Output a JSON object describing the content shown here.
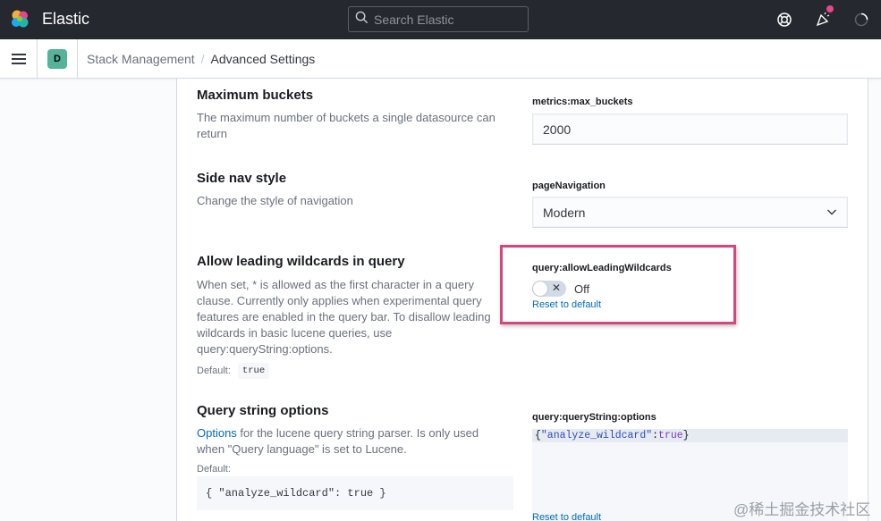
{
  "header": {
    "brand": "Elastic",
    "search_placeholder": "Search Elastic"
  },
  "subheader": {
    "space_initial": "D",
    "breadcrumbs": [
      "Stack Management",
      "Advanced Settings"
    ]
  },
  "settings": [
    {
      "title": "Maximum buckets",
      "description": "The maximum number of buckets a single datasource can return",
      "key": "metrics:max_buckets",
      "value": "2000"
    },
    {
      "title": "Side nav style",
      "description": "Change the style of navigation",
      "key": "pageNavigation",
      "value": "Modern"
    },
    {
      "title": "Allow leading wildcards in query",
      "description": "When set, * is allowed as the first character in a query clause. Currently only applies when experimental query features are enabled in the query bar. To disallow leading wildcards in basic lucene queries, use query:queryString:options.",
      "default_label": "Default:",
      "default_value": "true",
      "key": "query:allowLeadingWildcards",
      "toggle_label": "Off",
      "reset_label": "Reset to default"
    },
    {
      "title": "Query string options",
      "description_link": "Options",
      "description_rest": " for the lucene query string parser. Is only used when \"Query language\" is set to Lucene.",
      "default_label": "Default:",
      "default_value": "{ \"analyze_wildcard\": true }",
      "key": "query:queryString:options",
      "json_open": "{",
      "json_key": "\"analyze_wildcard\"",
      "json_colon": ":",
      "json_value": "true",
      "json_close": "}",
      "reset_label": "Reset to default"
    }
  ],
  "watermark": "@稀土掘金技术社区",
  "colors": {
    "header_bg": "#25282f",
    "highlight": "#d6457e",
    "link": "#006bb8",
    "space_avatar": "#54b399",
    "notification": "#e7468a"
  }
}
